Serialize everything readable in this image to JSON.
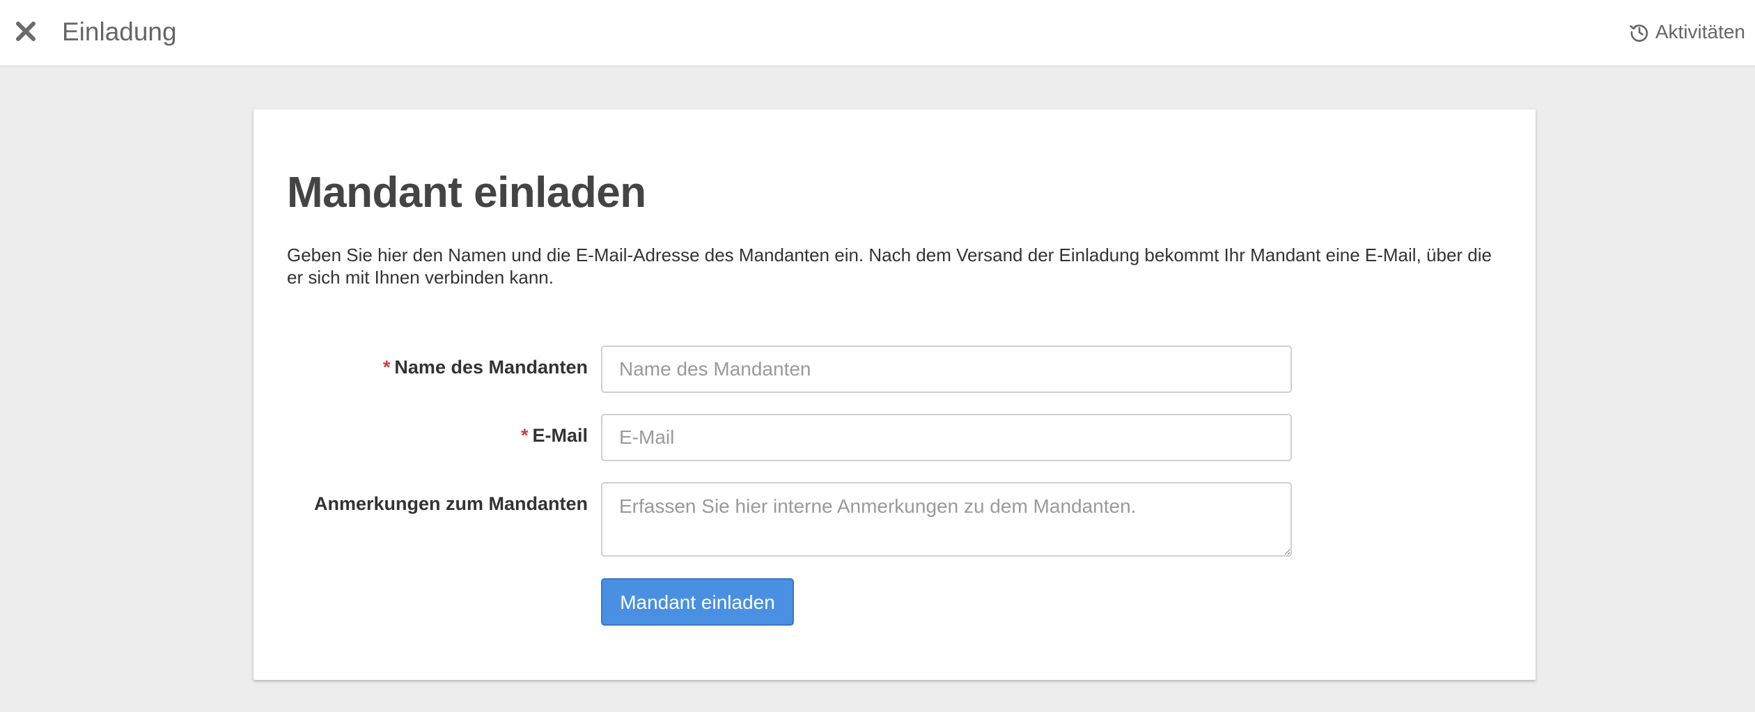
{
  "topbar": {
    "close_icon": "close-icon",
    "title": "Einladung",
    "activities_icon": "history-icon",
    "activities_label": "Aktivitäten"
  },
  "card": {
    "heading": "Mandant einladen",
    "intro": "Geben Sie hier den Namen und die E-Mail-Adresse des Mandanten ein. Nach dem Versand der Einladung bekommt Ihr Mandant eine E-Mail, über die er sich mit Ihnen verbinden kann.",
    "required_marker": "*",
    "fields": {
      "name": {
        "label": "Name des Mandanten",
        "required": true,
        "value": "",
        "placeholder": "Name des Mandanten"
      },
      "email": {
        "label": "E-Mail",
        "required": true,
        "value": "",
        "placeholder": "E-Mail"
      },
      "notes": {
        "label": "Anmerkungen zum Mandanten",
        "required": false,
        "value": "",
        "placeholder": "Erfassen Sie hier interne Anmerkungen zu dem Mandanten."
      }
    },
    "submit_label": "Mandant einladen"
  },
  "colors": {
    "background": "#ededed",
    "card": "#ffffff",
    "primary_button": "#4a90e2",
    "required_marker": "#d23b3b"
  }
}
